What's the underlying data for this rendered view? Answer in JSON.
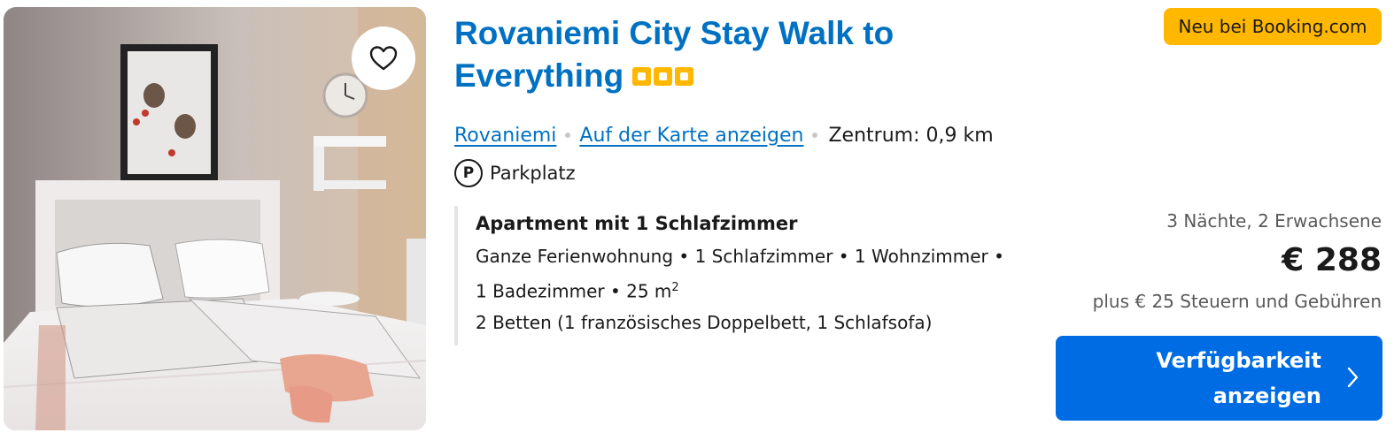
{
  "property": {
    "title": "Rovaniemi City Stay Walk to Everything",
    "star_count": 3,
    "badge": "Neu bei Booking.com",
    "city_link": "Rovaniemi",
    "map_link": "Auf der Karte anzeigen",
    "distance": "Zentrum: 0,9 km",
    "parking": "Parkplatz",
    "parking_icon_letter": "P"
  },
  "room": {
    "title": "Apartment mit 1 Schlafzimmer",
    "line1": "Ganze Ferienwohnung • 1 Schlafzimmer • 1 Wohnzimmer •",
    "line2_text": "1 Badezimmer • 25 m",
    "line2_sup": "2",
    "line3": "2 Betten (1 französisches Doppelbett, 1 Schlafsofa)"
  },
  "pricing": {
    "nights_guests": "3 Nächte, 2 Erwachsene",
    "price": "€ 288",
    "taxes": "plus € 25 Steuern und Gebühren"
  },
  "cta": {
    "line1": "Verfügbarkeit",
    "line2": "anzeigen"
  },
  "icons": {
    "favorite": "heart-icon",
    "parking": "parking-icon",
    "chevron": "chevron-right-icon"
  },
  "colors": {
    "brand_blue": "#0071c2",
    "cta_blue": "#006ce4",
    "badge_yellow": "#ffb700"
  }
}
